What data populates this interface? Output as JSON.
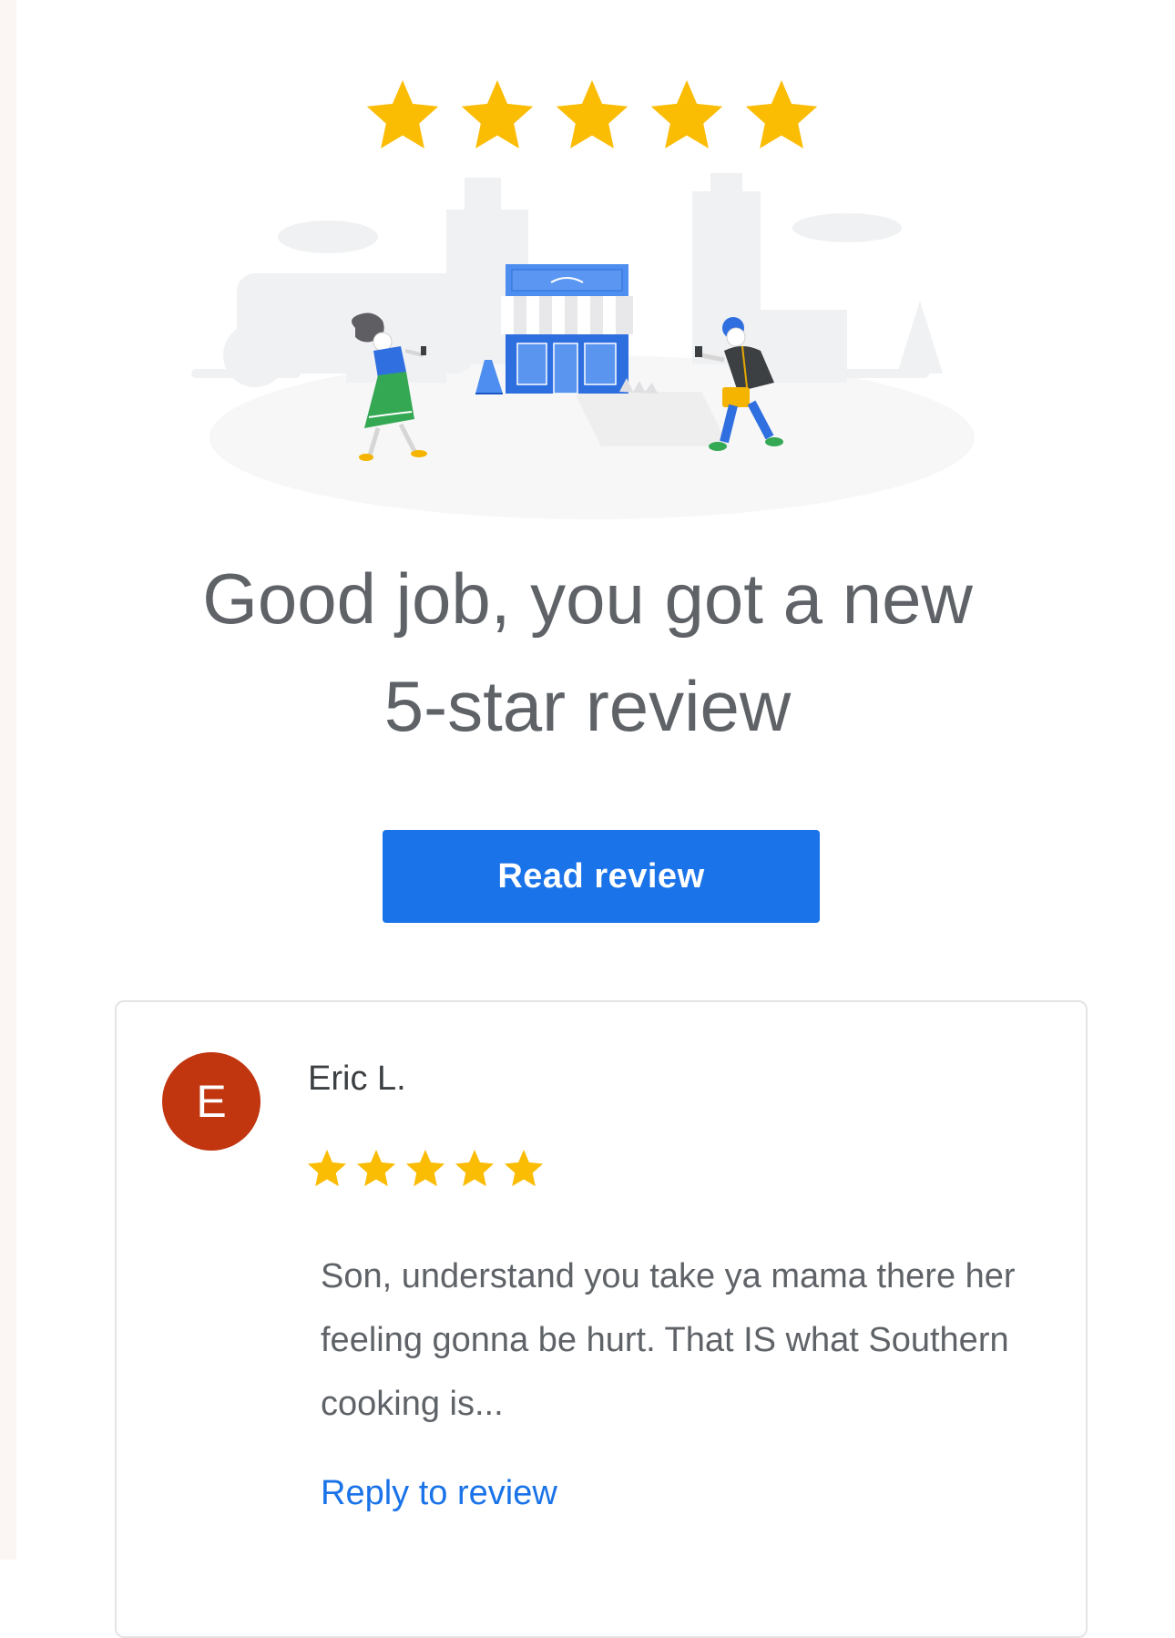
{
  "hero": {
    "rating_stars": 5,
    "star_color": "#FBBC04",
    "headline_line1": "Good job, you got a new",
    "headline_line2": "5-star review"
  },
  "actions": {
    "read_review_label": "Read review"
  },
  "review": {
    "avatar_letter": "E",
    "avatar_color": "#C1350F",
    "reviewer_name": "Eric L.",
    "rating_stars": 5,
    "text": "Son, understand you take ya mama there her feeling gonna be hurt. That IS what Southern cooking is...",
    "reply_label": "Reply to review"
  },
  "colors": {
    "primary_blue": "#1A73E8",
    "text_gray": "#5F6368"
  }
}
